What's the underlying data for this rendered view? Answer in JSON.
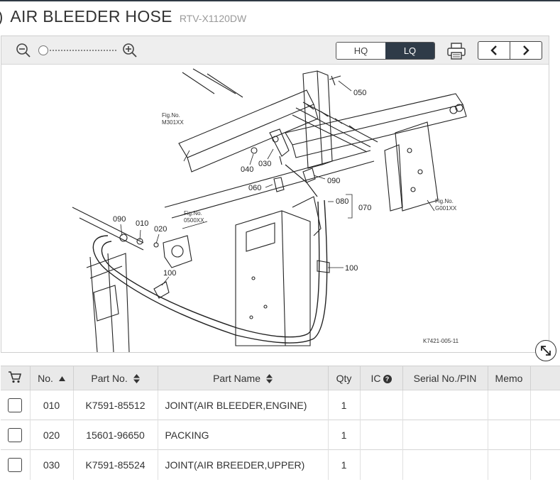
{
  "header": {
    "paren": ")",
    "title": "AIR BLEEDER HOSE",
    "model": "RTV-X1120DW"
  },
  "toolbar": {
    "zoom_out_icon": "zoom-out-icon",
    "zoom_in_icon": "zoom-in-icon",
    "zoom_level": 0,
    "quality_options": [
      "HQ",
      "LQ"
    ],
    "quality_selected": "LQ",
    "print_icon": "printer-icon",
    "prev_icon": "chevron-left-icon",
    "next_icon": "chevron-right-icon"
  },
  "diagram": {
    "labels": {
      "p050": "050",
      "p030": "030",
      "p040": "040",
      "p060": "060",
      "p090a": "090",
      "p080": "080",
      "p070": "070",
      "p090b": "090",
      "p010": "010",
      "p020": "020",
      "p100a": "100",
      "p100b": "100"
    },
    "refs": {
      "m301_a": "Fig.No.",
      "m301_b": "M301XX",
      "g001_a": "Fig.No.",
      "g001_b": "G001XX",
      "e500_a": "Fig.No.",
      "e500_b": "0500XX"
    },
    "code": "K7421-005-11",
    "line_color": "#222222"
  },
  "table": {
    "headers": {
      "no": "No.",
      "part_no": "Part No.",
      "part_name": "Part Name",
      "qty": "Qty",
      "ic": "IC",
      "serial": "Serial No./PIN",
      "memo": "Memo"
    },
    "rows": [
      {
        "no": "010",
        "part_no": "K7591-85512",
        "part_name": "JOINT(AIR BLEEDER,ENGINE)",
        "qty": "1",
        "ic": "",
        "serial": "",
        "memo": ""
      },
      {
        "no": "020",
        "part_no": "15601-96650",
        "part_name": "PACKING",
        "qty": "1",
        "ic": "",
        "serial": "",
        "memo": ""
      },
      {
        "no": "030",
        "part_no": "K7591-85524",
        "part_name": "JOINT(AIR BREEDER,UPPER)",
        "qty": "1",
        "ic": "",
        "serial": "",
        "memo": ""
      }
    ]
  },
  "colors": {
    "accent_dark": "#2f3b48",
    "header_bg": "#e9e9e9",
    "toolbar_bg": "#eeeeee"
  }
}
